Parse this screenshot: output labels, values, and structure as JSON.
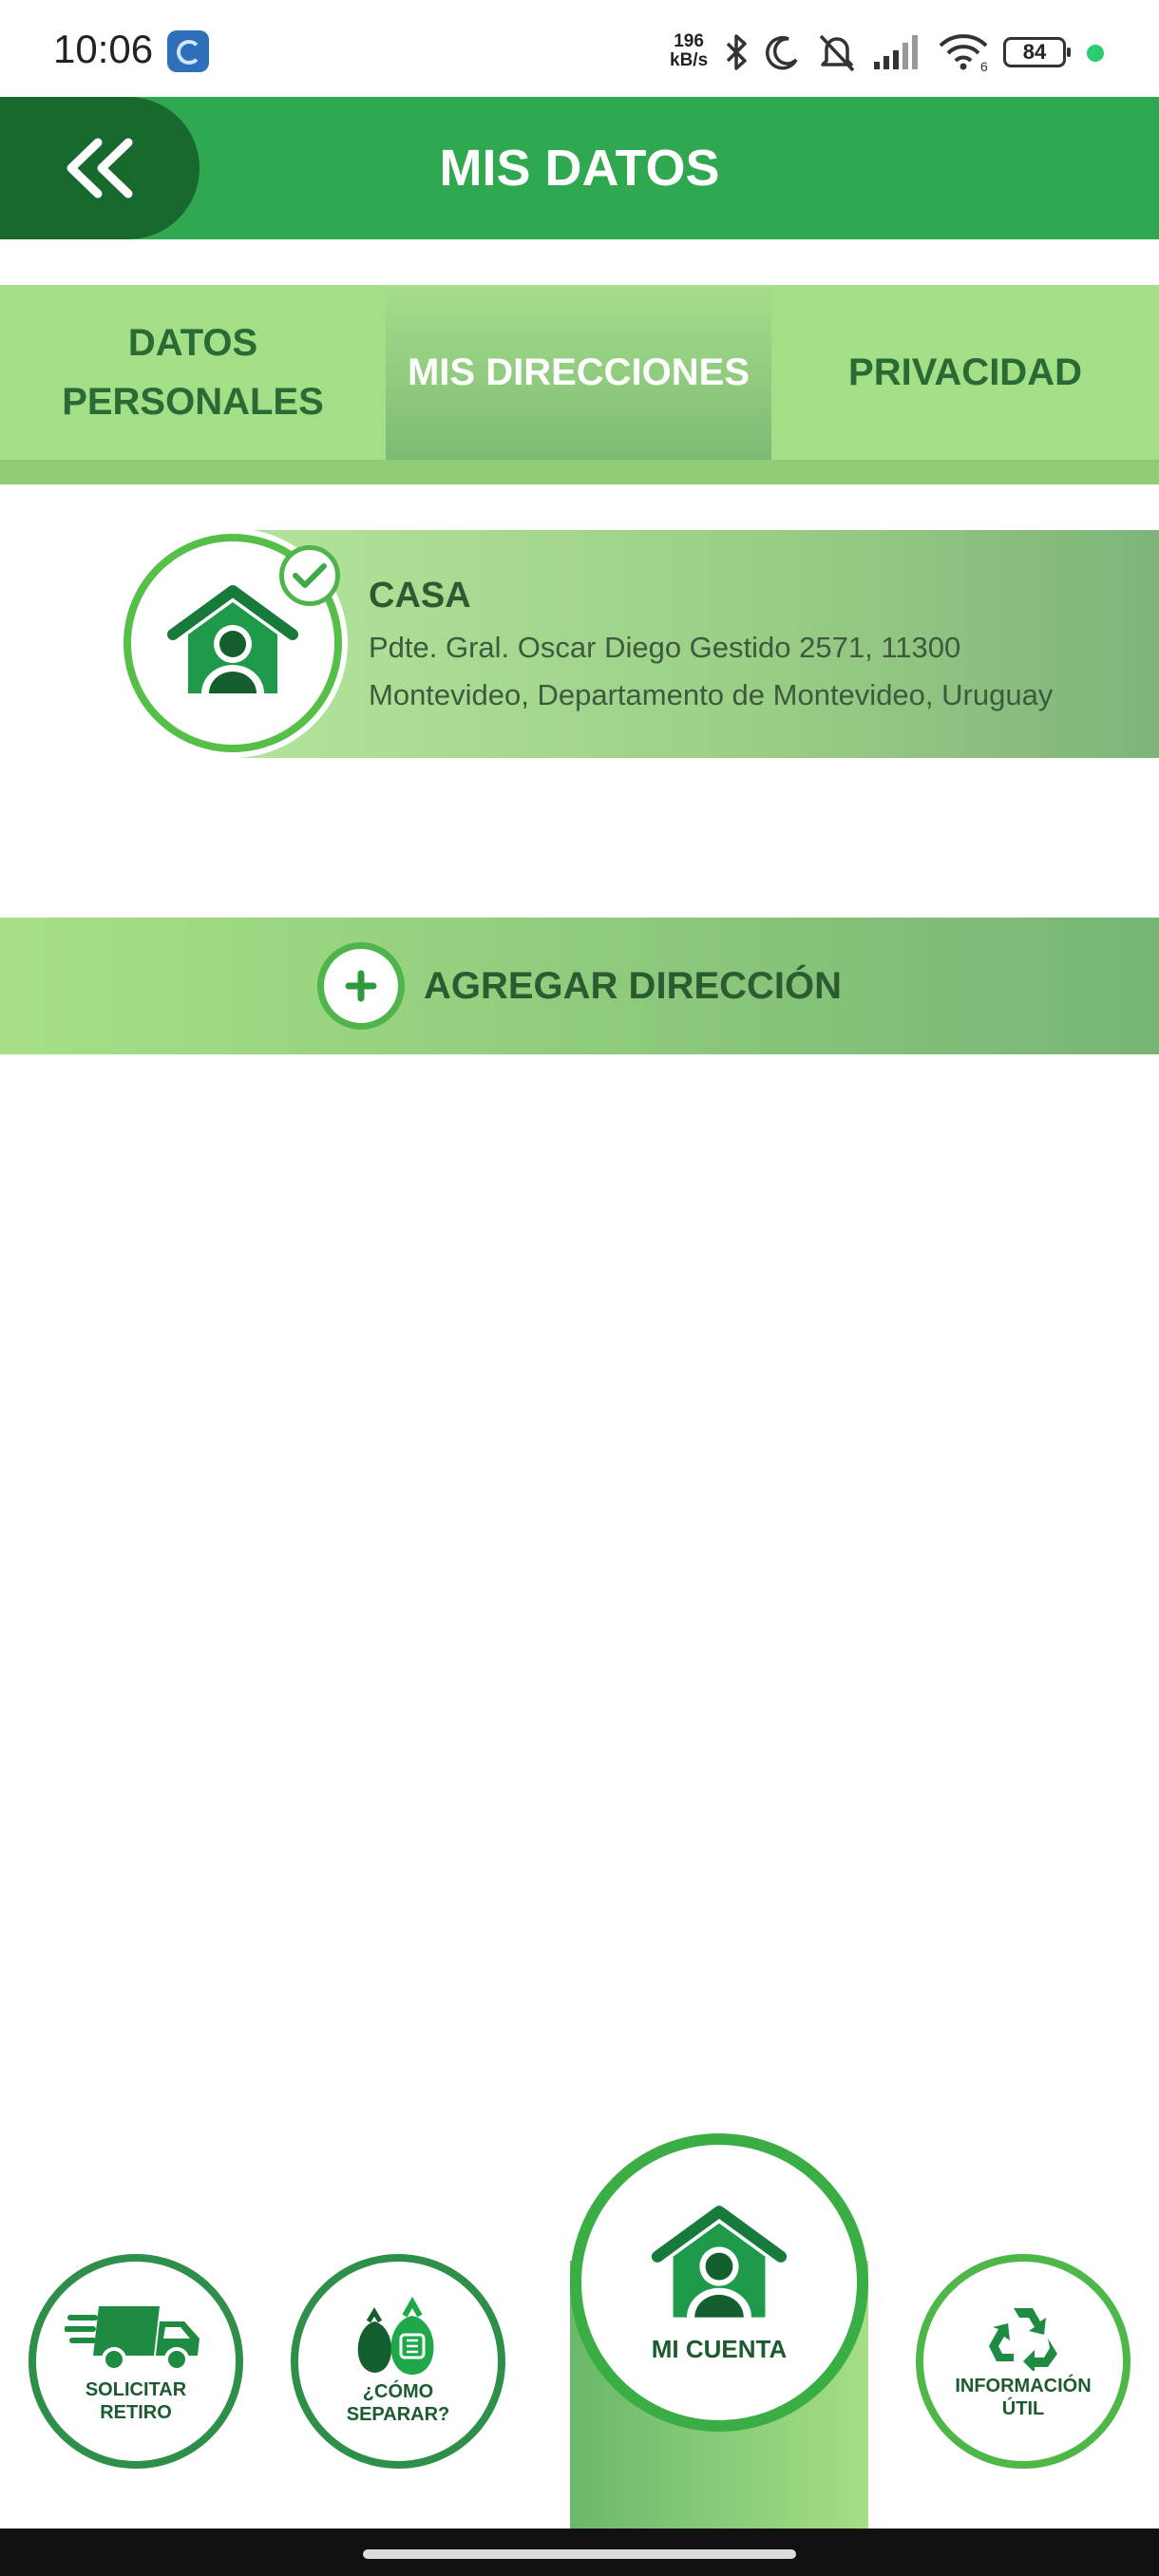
{
  "status_bar": {
    "time": "10:06",
    "speed_value": "196",
    "speed_unit": "kB/s",
    "battery": "84",
    "wifi_badge": "6"
  },
  "header": {
    "title": "MIS DATOS",
    "back_icon": "double-chevron-left-icon"
  },
  "tabs": [
    {
      "line1": "DATOS",
      "line2": "PERSONALES",
      "active": false
    },
    {
      "label": "MIS DIRECCIONES",
      "active": true
    },
    {
      "label": "PRIVACIDAD",
      "active": false
    }
  ],
  "addresses": [
    {
      "name": "CASA",
      "line1": "Pdte. Gral. Oscar Diego Gestido 2571, 11300",
      "line2": "Montevideo, Departamento de Montevideo, Uruguay",
      "selected": true
    }
  ],
  "add_address": {
    "label": "AGREGAR DIRECCIÓN"
  },
  "bottom_nav": {
    "solicitar": {
      "line1": "SOLICITAR",
      "line2": "RETIRO"
    },
    "separar": {
      "line1": "¿CÓMO",
      "line2": "SEPARAR?"
    },
    "mi_cuenta": {
      "label": "MI CUENTA"
    },
    "info": {
      "line1": "INFORMACIÓN",
      "line2": "ÚTIL"
    }
  },
  "colors": {
    "header": "#2fa84f",
    "back_button": "#17692e",
    "tab_bar": "#a4df87",
    "text_dark_green": "#2c5b31",
    "accent_green": "#4fb54a"
  }
}
